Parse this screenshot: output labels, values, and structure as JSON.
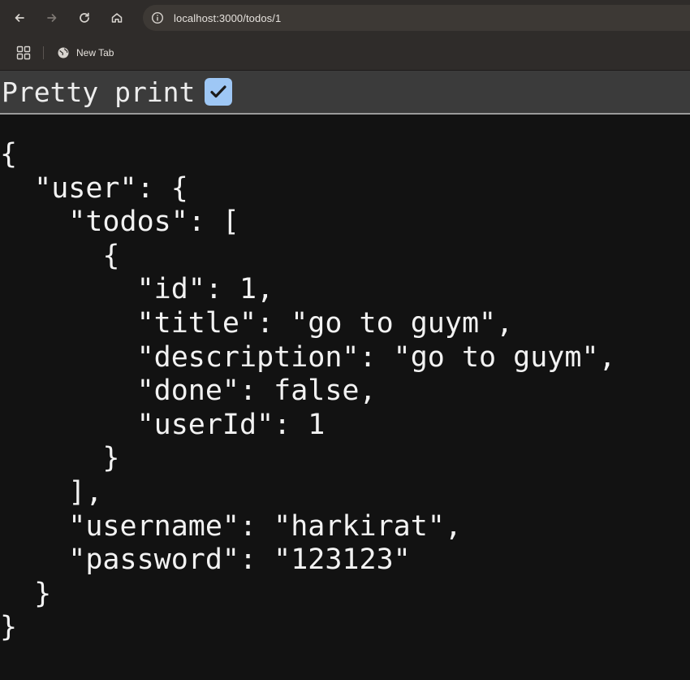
{
  "browser": {
    "url": "localhost:3000/todos/1",
    "bookmarks": [
      {
        "label": "New Tab",
        "icon": "globe-icon"
      }
    ],
    "icons": {
      "back": "back-arrow-icon",
      "forward": "forward-arrow-icon",
      "reload": "reload-icon",
      "home": "home-icon",
      "site_info": "info-icon",
      "apps": "apps-grid-icon"
    }
  },
  "viewer": {
    "pretty_print_label": "Pretty print",
    "pretty_print_checked": true,
    "accent_color": "#9ec7f5"
  },
  "json_lines": [
    "{",
    "  \"user\": {",
    "    \"todos\": [",
    "      {",
    "        \"id\": 1,",
    "        \"title\": \"go to guym\",",
    "        \"description\": \"go to guym\",",
    "        \"done\": false,",
    "        \"userId\": 1",
    "      }",
    "    ],",
    "    \"username\": \"harkirat\",",
    "    \"password\": \"123123\"",
    "  }",
    "}"
  ]
}
